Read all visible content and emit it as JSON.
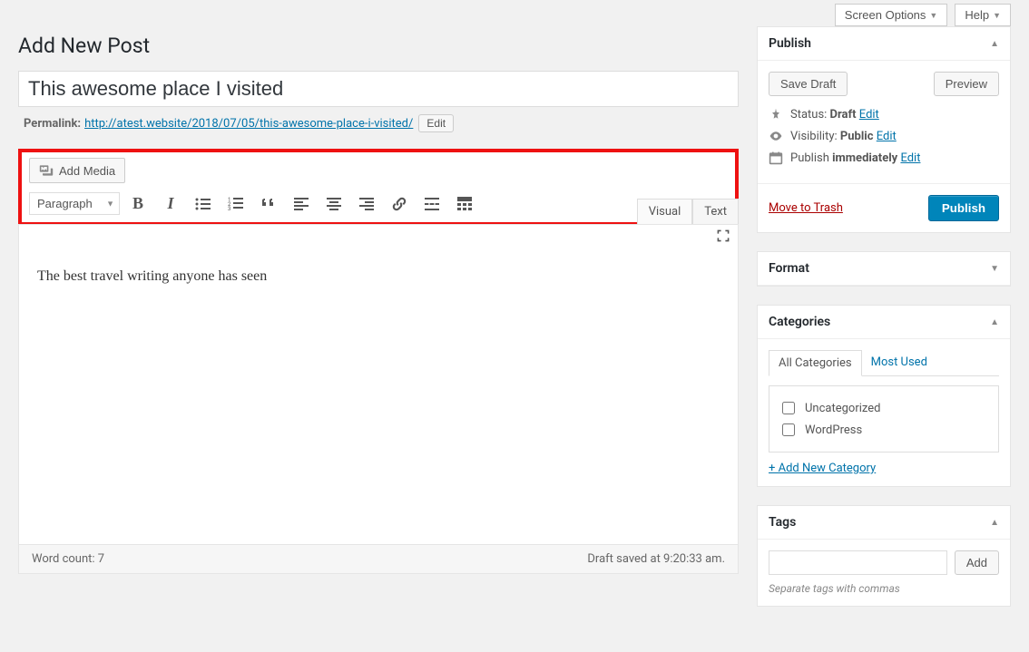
{
  "top": {
    "screen_options": "Screen Options",
    "help": "Help"
  },
  "page_title": "Add New Post",
  "title_value": "This awesome place I visited",
  "permalink": {
    "label": "Permalink:",
    "url_prefix": "http://atest.website/2018/07/05/",
    "slug": "this-awesome-place-i-visited",
    "url_suffix": "/",
    "edit": "Edit"
  },
  "editor": {
    "add_media": "Add Media",
    "format_sel": "Paragraph",
    "tabs": {
      "visual": "Visual",
      "text": "Text"
    },
    "body": "The best travel writing anyone has seen",
    "word_count_label": "Word count: ",
    "word_count": "7",
    "save_status": "Draft saved at 9:20:33 am."
  },
  "publish": {
    "heading": "Publish",
    "save_draft": "Save Draft",
    "preview": "Preview",
    "status_label": "Status: ",
    "status_value": "Draft",
    "visibility_label": "Visibility: ",
    "visibility_value": "Public",
    "schedule_label": "Publish ",
    "schedule_value": "immediately",
    "edit": "Edit",
    "trash": "Move to Trash",
    "submit": "Publish"
  },
  "format_box": {
    "heading": "Format"
  },
  "categories": {
    "heading": "Categories",
    "tab_all": "All Categories",
    "tab_most": "Most Used",
    "items": [
      "Uncategorized",
      "WordPress"
    ],
    "add_new": "+ Add New Category"
  },
  "tags": {
    "heading": "Tags",
    "add": "Add",
    "hint": "Separate tags with commas"
  }
}
